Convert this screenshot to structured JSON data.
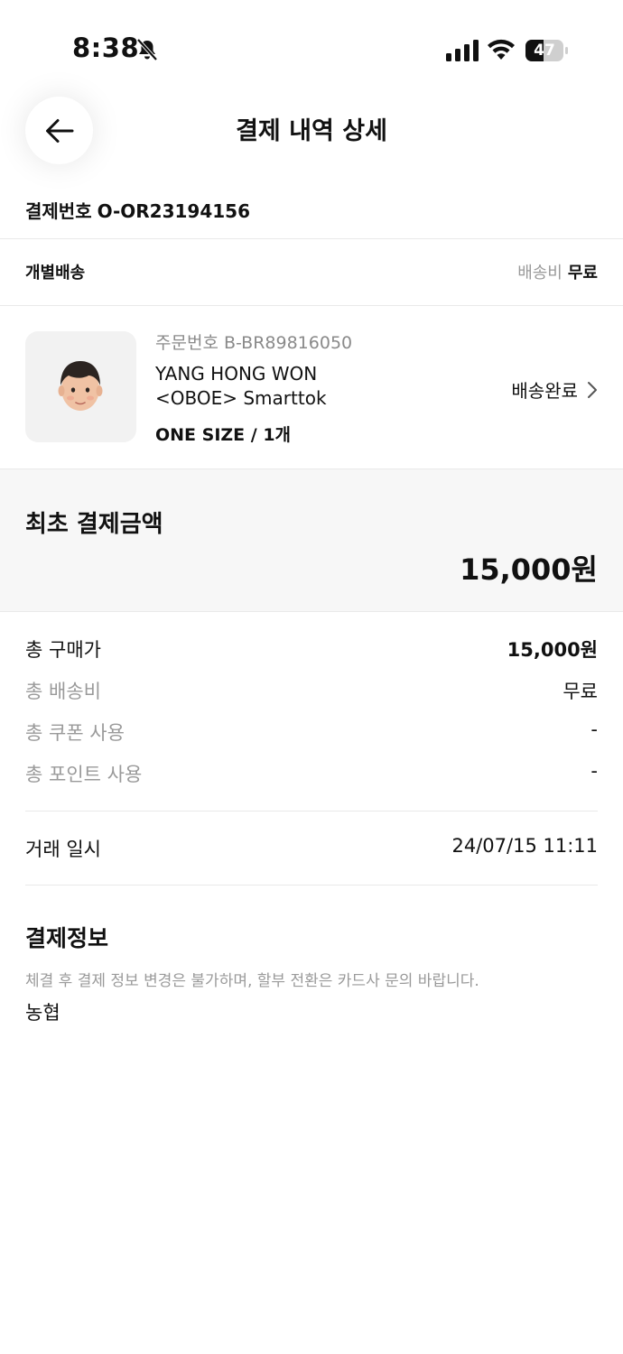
{
  "status_bar": {
    "time": "8:38",
    "battery_level": "47",
    "battery_fraction": 0.47,
    "icons": [
      "bell-slash-icon",
      "cellular-signal-icon",
      "wifi-icon",
      "battery-icon"
    ]
  },
  "header": {
    "back_icon": "arrow-left-icon",
    "title": "결제 내역 상세"
  },
  "payment": {
    "label": "결제번호",
    "number": "O-OR23194156"
  },
  "shipping": {
    "type": "개별배송",
    "fee_label": "배송비",
    "fee_value": "무료"
  },
  "product": {
    "order_no": "주문번호 B-BR89816050",
    "name_line1": "YANG HONG WON",
    "name_line2": "<OBOE> Smarttok",
    "option": "ONE SIZE / 1개",
    "status": "배송완료",
    "status_icon": "chevron-right-icon"
  },
  "initial_total": {
    "title": "최초 결제금액",
    "amount": "15,000원"
  },
  "summary": [
    {
      "label": "총 구매가",
      "value": "15,000원"
    },
    {
      "label": "총 배송비",
      "value": "무료"
    },
    {
      "label": "총 쿠폰 사용",
      "value": "-"
    },
    {
      "label": "총 포인트 사용",
      "value": "-"
    }
  ],
  "transaction": {
    "label": "거래 일시",
    "value": "24/07/15 11:11"
  },
  "payment_info": {
    "title": "결제정보",
    "note": "체결 후 결제 정보 변경은 불가하며, 할부 전환은 카드사 문의 바랍니다.",
    "bank": "농협"
  },
  "colors": {
    "text_primary": "#111111",
    "text_secondary": "#9a9a9a",
    "divider": "#e9e9e9",
    "total_bg": "#f7f7f7",
    "thumb_bg": "#f2f2f2"
  }
}
